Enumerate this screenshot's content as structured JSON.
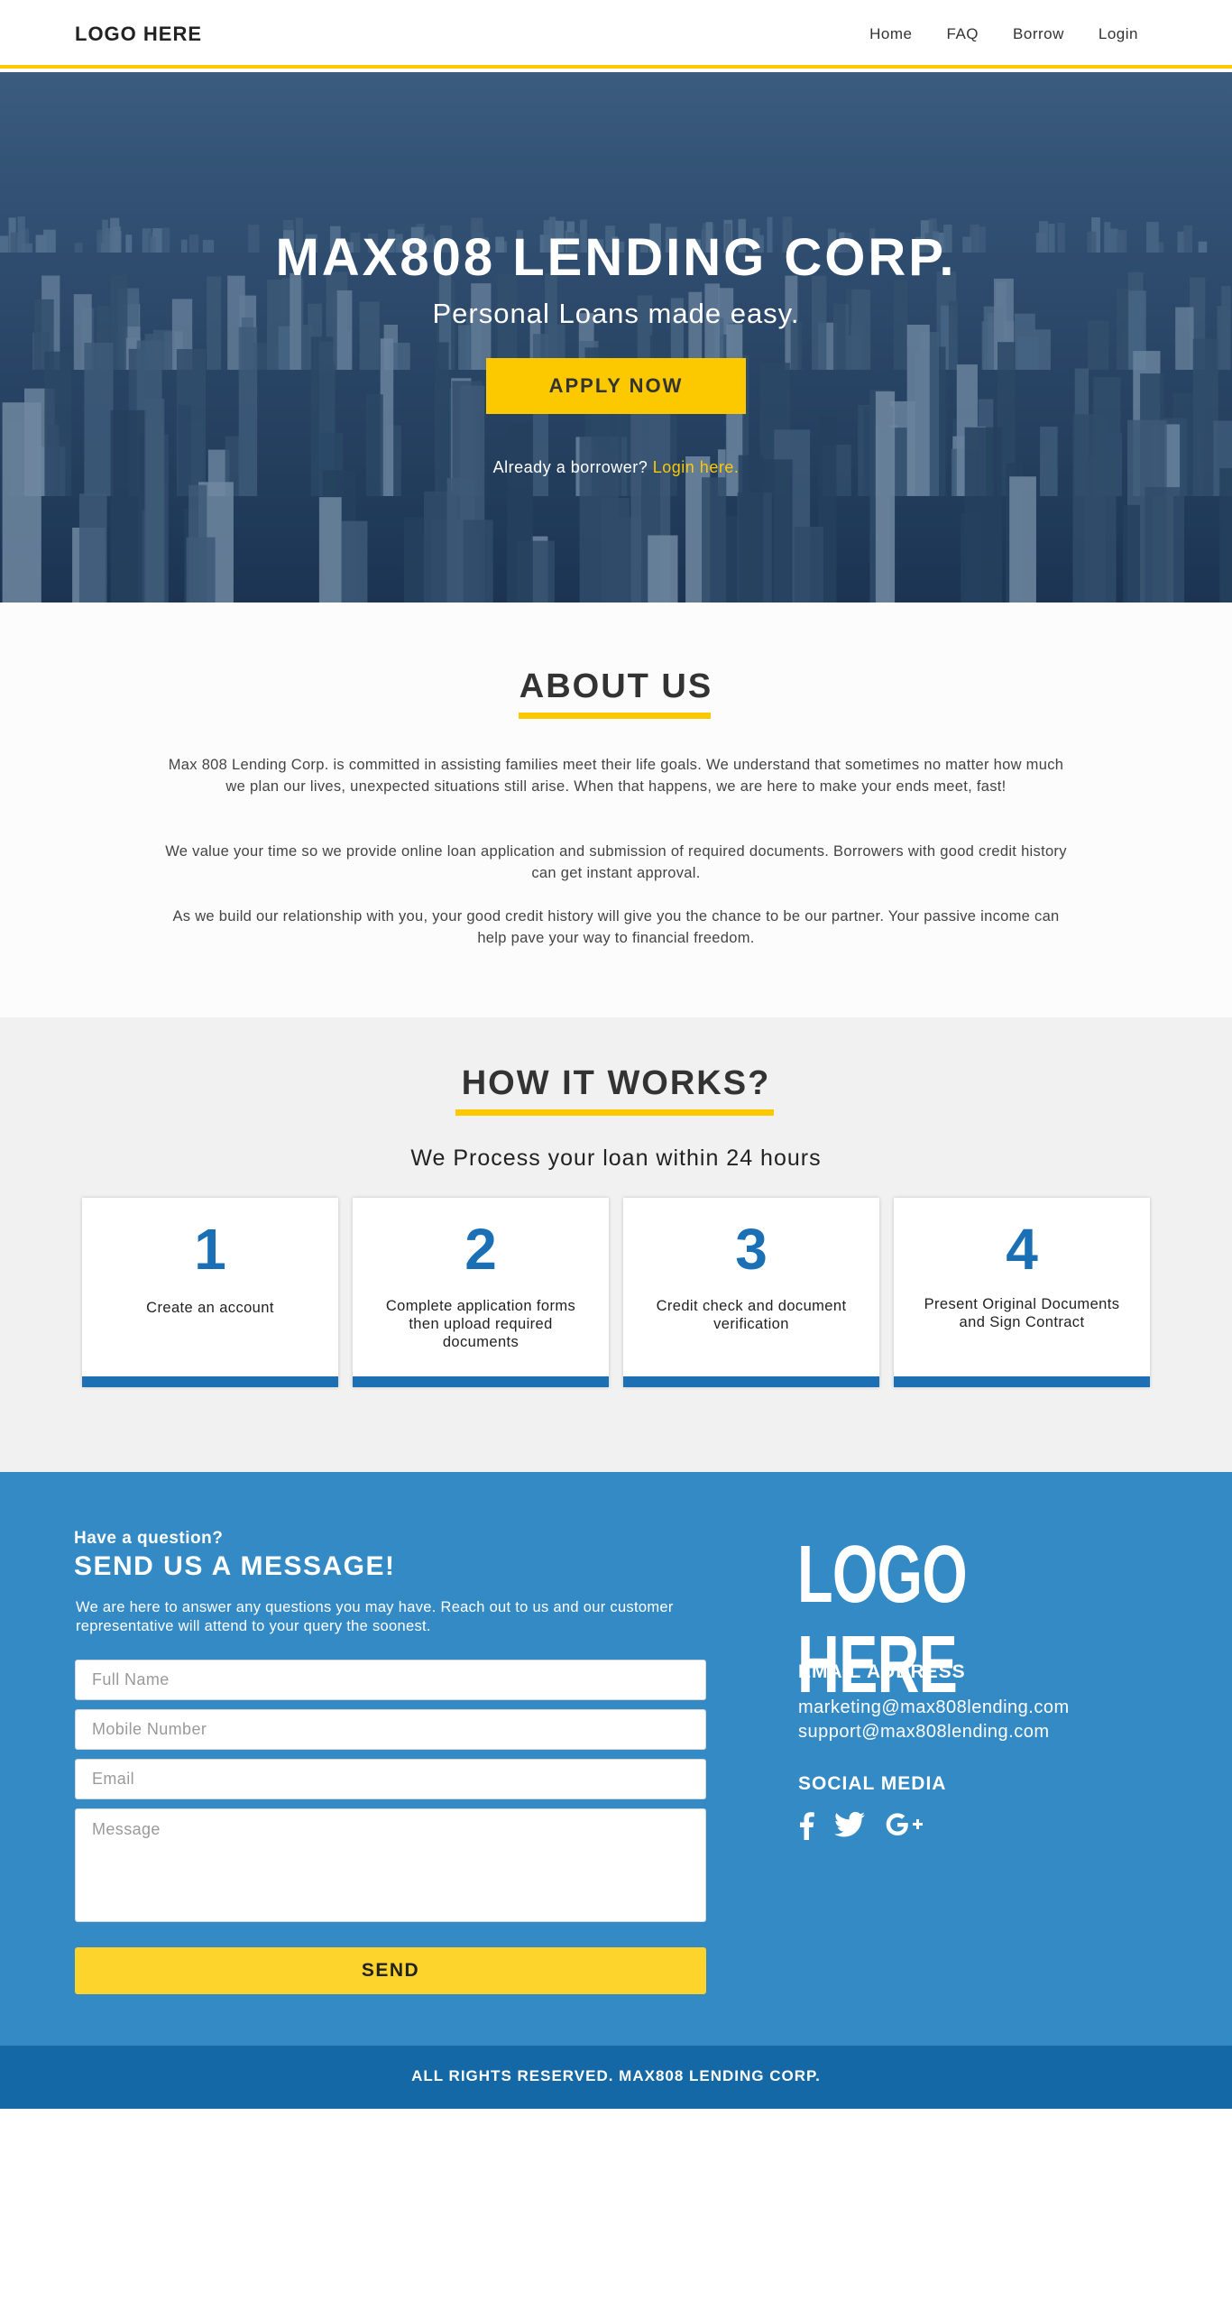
{
  "nav": {
    "logo": "LOGO HERE",
    "links": [
      "Home",
      "FAQ",
      "Borrow",
      "Login"
    ]
  },
  "hero": {
    "title": "MAX808 LENDING CORP.",
    "subtitle": "Personal Loans made easy.",
    "apply_label": "APPLY NOW",
    "login_prompt": "Already a borrower?",
    "login_link": "Login here."
  },
  "about": {
    "heading": "ABOUT US",
    "paragraphs": [
      "Max 808 Lending Corp. is committed in assisting families meet their life goals. We understand that sometimes no matter how much we plan our lives, unexpected situations still arise. When that happens, we are here to make your ends meet, fast!",
      "We value your time so we provide online loan application and submission of required documents. Borrowers with good credit history can get instant approval.",
      "As we build our relationship with you, your good credit history will give you the chance to be our partner. Your passive income can help pave your way to financial freedom."
    ]
  },
  "how": {
    "heading": "HOW IT WORKS?",
    "subtitle": "We Process your loan within 24 hours",
    "steps": [
      {
        "number": "1",
        "label": "Create an account"
      },
      {
        "number": "2",
        "label": "Complete application forms then upload required documents"
      },
      {
        "number": "3",
        "label": "Credit check and document verification"
      },
      {
        "number": "4",
        "label": "Present Original Documents and Sign Contract"
      }
    ]
  },
  "contact": {
    "question": "Have a question?",
    "title": "SEND US A MESSAGE!",
    "description": "We are here to answer any questions you may have. Reach out to us and our customer representative will attend to your query the soonest.",
    "placeholders": {
      "full_name": "Full Name",
      "mobile": "Mobile Number",
      "email": "Email",
      "message": "Message"
    },
    "send_label": "SEND",
    "logo": "LOGO HERE",
    "email_heading": "EMAIL ADDRESS",
    "emails": [
      "marketing@max808lending.com",
      "support@max808lending.com"
    ],
    "social_heading": "SOCIAL MEDIA",
    "social_icons": [
      "facebook-icon",
      "twitter-icon",
      "google-plus-icon"
    ]
  },
  "footer": {
    "text": "ALL RIGHTS RESERVED. MAX808 LENDING CORP."
  },
  "colors": {
    "accent": "#fcc900",
    "primary_blue": "#348ac4",
    "step_blue": "#1a6fb5",
    "footer_blue": "#1468a6"
  }
}
